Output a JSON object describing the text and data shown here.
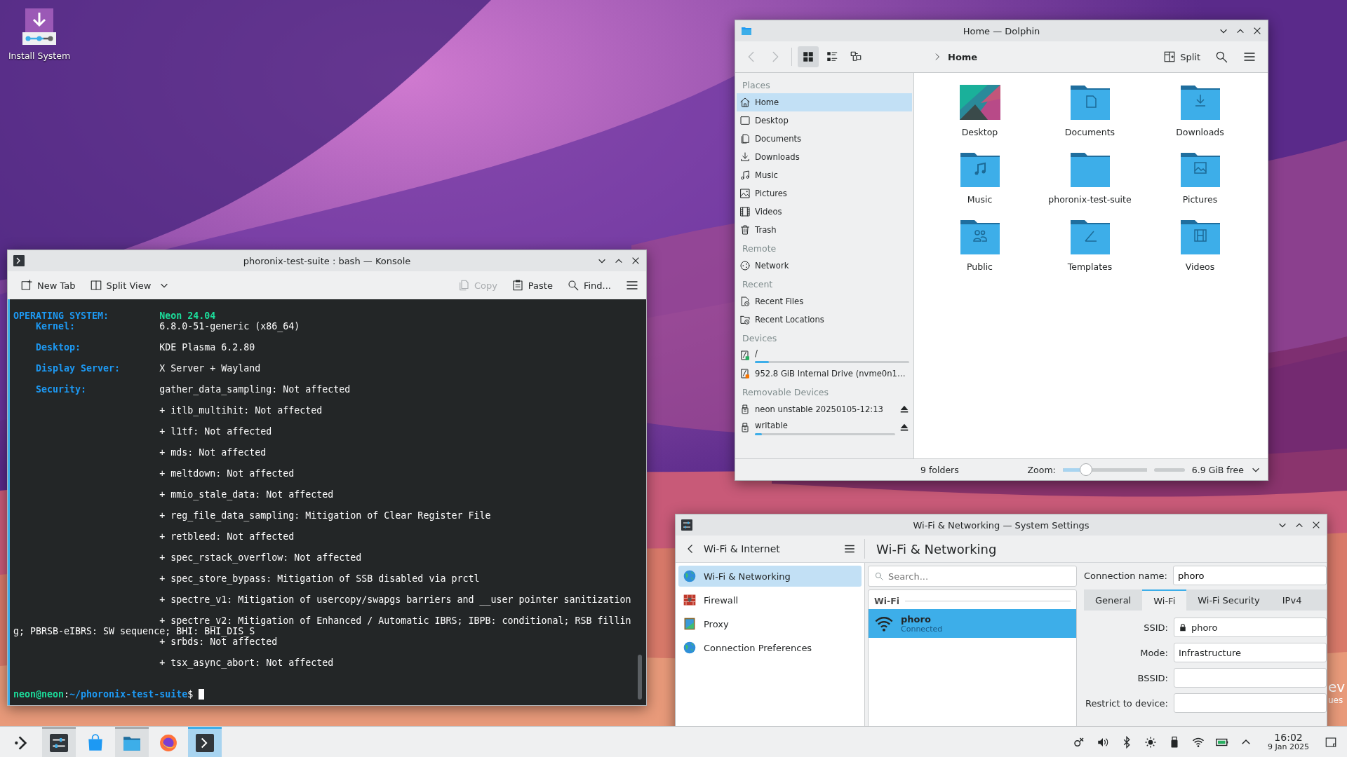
{
  "desktop": {
    "icons": [
      {
        "label": "Install System"
      }
    ],
    "widget_fragments": [
      "ev",
      "ues"
    ]
  },
  "konsole": {
    "title": "phoronix-test-suite : bash — Konsole",
    "toolbar": [
      {
        "kind": "new-tab",
        "label": "New Tab",
        "disabled": false
      },
      {
        "kind": "split-view",
        "label": "Split View",
        "disabled": false
      },
      {
        "kind": "copy",
        "label": "Copy",
        "disabled": true
      },
      {
        "kind": "paste",
        "label": "Paste",
        "disabled": false
      },
      {
        "kind": "find",
        "label": "Find...",
        "disabled": false
      }
    ],
    "lines": [
      {
        "kind": "heading",
        "label": "OPERATING SYSTEM:",
        "value": "Neon 24.04"
      },
      {
        "kind": "field",
        "label": "Kernel:",
        "value": "6.8.0-51-generic (x86_64)"
      },
      {
        "kind": "field",
        "label": "Desktop:",
        "value": "KDE Plasma 6.2.80"
      },
      {
        "kind": "field",
        "label": "Display Server:",
        "value": "X Server + Wayland"
      },
      {
        "kind": "field",
        "label": "Security:",
        "value": "gather_data_sampling: Not affected"
      },
      {
        "kind": "item",
        "value": "+ itlb_multihit: Not affected"
      },
      {
        "kind": "item",
        "value": "+ l1tf: Not affected"
      },
      {
        "kind": "item",
        "value": "+ mds: Not affected"
      },
      {
        "kind": "item",
        "value": "+ meltdown: Not affected"
      },
      {
        "kind": "item",
        "value": "+ mmio_stale_data: Not affected"
      },
      {
        "kind": "item",
        "value": "+ reg_file_data_sampling: Mitigation of Clear Register File"
      },
      {
        "kind": "item",
        "value": "+ retbleed: Not affected"
      },
      {
        "kind": "item",
        "value": "+ spec_rstack_overflow: Not affected"
      },
      {
        "kind": "item",
        "value": "+ spec_store_bypass: Mitigation of SSB disabled via prctl"
      },
      {
        "kind": "item",
        "value": "+ spectre_v1: Mitigation of usercopy/swapgs barriers and __user pointer sanitization"
      },
      {
        "kind": "item",
        "value": "+ spectre_v2: Mitigation of Enhanced / Automatic IBRS; IBPB: conditional; RSB fillin"
      },
      {
        "kind": "wrap",
        "value": "g; PBRSB-eIBRS: SW sequence; BHI: BHI_DIS_S"
      },
      {
        "kind": "item",
        "value": "+ srbds: Not affected"
      },
      {
        "kind": "item",
        "value": "+ tsx_async_abort: Not affected"
      }
    ],
    "prompt": {
      "user_host": "neon@neon",
      "separator": ":",
      "path": "~/phoronix-test-suite",
      "symbol": "$"
    }
  },
  "dolphin": {
    "title": "Home — Dolphin",
    "nav": [
      {
        "kind": "back",
        "disabled": true
      },
      {
        "kind": "forward",
        "disabled": true
      }
    ],
    "view_modes": [
      {
        "kind": "icons",
        "selected": true
      },
      {
        "kind": "compact",
        "selected": false
      },
      {
        "kind": "tree",
        "selected": false
      }
    ],
    "breadcrumb": "Home",
    "split_label": "Split",
    "places": [
      {
        "title": "Places",
        "items": [
          {
            "kind": "home",
            "label": "Home",
            "selected": true
          },
          {
            "kind": "desktop",
            "label": "Desktop",
            "selected": false
          },
          {
            "kind": "documents",
            "label": "Documents",
            "selected": false
          },
          {
            "kind": "downloads",
            "label": "Downloads",
            "selected": false
          },
          {
            "kind": "music",
            "label": "Music",
            "selected": false
          },
          {
            "kind": "pictures",
            "label": "Pictures",
            "selected": false
          },
          {
            "kind": "videos",
            "label": "Videos",
            "selected": false
          },
          {
            "kind": "trash",
            "label": "Trash",
            "selected": false
          }
        ]
      },
      {
        "title": "Remote",
        "items": [
          {
            "kind": "network",
            "label": "Network",
            "selected": false
          }
        ]
      },
      {
        "title": "Recent",
        "items": [
          {
            "kind": "recent-files",
            "label": "Recent Files",
            "selected": false
          },
          {
            "kind": "recent-locations",
            "label": "Recent Locations",
            "selected": false
          }
        ]
      },
      {
        "title": "Devices",
        "items": [
          {
            "kind": "drive-mounted",
            "label": "/",
            "selected": false,
            "level": 0.09
          },
          {
            "kind": "drive",
            "label": "952.8 GiB Internal Drive (nvme0n1…",
            "selected": false
          }
        ]
      },
      {
        "title": "Removable Devices",
        "items": [
          {
            "kind": "usb",
            "label": "neon unstable 20250105-12:13",
            "selected": false,
            "ejectable": true
          },
          {
            "kind": "usb",
            "label": "writable",
            "selected": false,
            "ejectable": true,
            "level": 0.05
          }
        ]
      }
    ],
    "folders": [
      {
        "kind": "wallpaper",
        "label": "Desktop"
      },
      {
        "kind": "documents",
        "label": "Documents"
      },
      {
        "kind": "downloads",
        "label": "Downloads"
      },
      {
        "kind": "music",
        "label": "Music"
      },
      {
        "kind": "plain",
        "label": "phoronix-test-suite"
      },
      {
        "kind": "pictures",
        "label": "Pictures"
      },
      {
        "kind": "public",
        "label": "Public"
      },
      {
        "kind": "templates",
        "label": "Templates"
      },
      {
        "kind": "videos",
        "label": "Videos"
      }
    ],
    "status": {
      "count": "9 folders",
      "zoom_label": "Zoom:",
      "zoom": {
        "level": 0.28
      },
      "free": "6.9 GiB free"
    }
  },
  "settings": {
    "title": "Wi-Fi & Networking — System Settings",
    "back_label": "Wi-Fi & Internet",
    "heading": "Wi-Fi & Networking",
    "categories": [
      {
        "kind": "globe",
        "label": "Wi-Fi & Networking",
        "selected": true
      },
      {
        "kind": "firewall",
        "label": "Firewall",
        "selected": false
      },
      {
        "kind": "proxy",
        "label": "Proxy",
        "selected": false
      },
      {
        "kind": "globe",
        "label": "Connection Preferences",
        "selected": false
      }
    ],
    "search": {
      "placeholder": "Search..."
    },
    "list_section": "Wi-Fi",
    "networks": [
      {
        "name": "phoro",
        "status": "Connected",
        "selected": true
      }
    ],
    "connection_name": {
      "label": "Connection name:",
      "value": "phoro"
    },
    "tabs": [
      {
        "label": "General",
        "selected": false
      },
      {
        "label": "Wi-Fi",
        "selected": true
      },
      {
        "label": "Wi-Fi Security",
        "selected": false
      },
      {
        "label": "IPv4",
        "selected": false
      }
    ],
    "form": [
      {
        "kind": "locked",
        "label": "SSID:",
        "value": "phoro"
      },
      {
        "kind": "combo",
        "label": "Mode:",
        "value": "Infrastructure"
      },
      {
        "kind": "text",
        "label": "BSSID:"
      },
      {
        "kind": "text",
        "label": "Restrict to device:"
      }
    ]
  },
  "taskbar": {
    "apps": [
      {
        "kind": "launcher",
        "running": false,
        "active": false
      },
      {
        "kind": "settings",
        "running": true,
        "active": false
      },
      {
        "kind": "store",
        "running": false,
        "active": false
      },
      {
        "kind": "files",
        "running": true,
        "active": false
      },
      {
        "kind": "browser",
        "running": false,
        "active": false
      },
      {
        "kind": "terminal",
        "running": true,
        "active": true
      }
    ],
    "tray": [
      {
        "kind": "connect"
      },
      {
        "kind": "volume"
      },
      {
        "kind": "bluetooth"
      },
      {
        "kind": "brightness"
      },
      {
        "kind": "usb"
      },
      {
        "kind": "wifi"
      },
      {
        "kind": "battery"
      },
      {
        "kind": "expand"
      }
    ],
    "time": "16:02",
    "date": "9 Jan 2025"
  }
}
